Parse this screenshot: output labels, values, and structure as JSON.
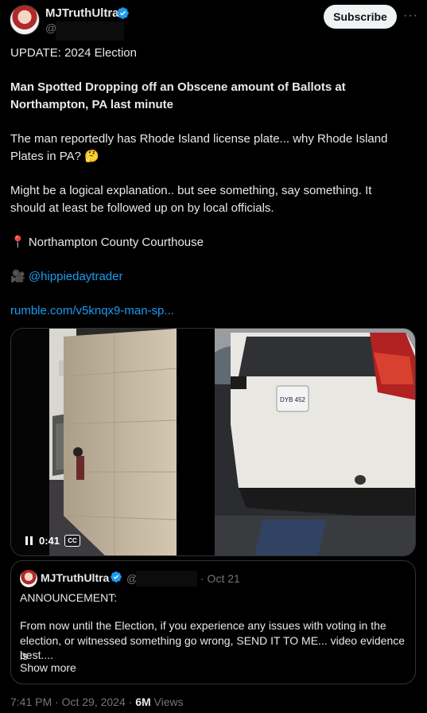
{
  "tweet": {
    "author_name": "MJTruthUltra",
    "handle_prefix": "@",
    "subscribe_label": "Subscribe",
    "more_label": "···",
    "line_update": "UPDATE: 2024 Election",
    "headline_1": "Man Spotted Dropping off an Obscene amount of Ballots at",
    "headline_2": "Northampton, PA last minute",
    "para1_1": "The man reportedly has Rhode Island license plate... why Rhode Island",
    "para1_2": "Plates in PA? 🤔",
    "para2_1": "Might be a logical explanation.. but see something, say something. It",
    "para2_2": "should at least be followed up on by local officials.",
    "location": "📍 Northampton County Courthouse",
    "video_credit_icon": "🎥",
    "video_credit": "@hippiedaytrader",
    "link": "rumble.com/v5knqx9-man-sp...",
    "video_time": "0:41",
    "cc_label": "CC",
    "plate_text": "DYB 452",
    "timestamp": "7:41 PM · Oct 29, 2024 · ",
    "views_count": "6M",
    "views_label": " Views"
  },
  "quote": {
    "author_name": "MJTruthUltra",
    "handle_prefix": "@",
    "date": "· Oct 21",
    "line1": "ANNOUNCEMENT:",
    "line2_1": "From now until the Election, if you experience any issues with voting in the",
    "line2_2": "election, or witnessed something go wrong, SEND IT TO ME... video evidence is",
    "line2_3": "best....",
    "show_more": "Show more"
  },
  "colors": {
    "accent": "#1d9bf0",
    "verified": "#1d9bf0",
    "muted": "#71767b"
  }
}
